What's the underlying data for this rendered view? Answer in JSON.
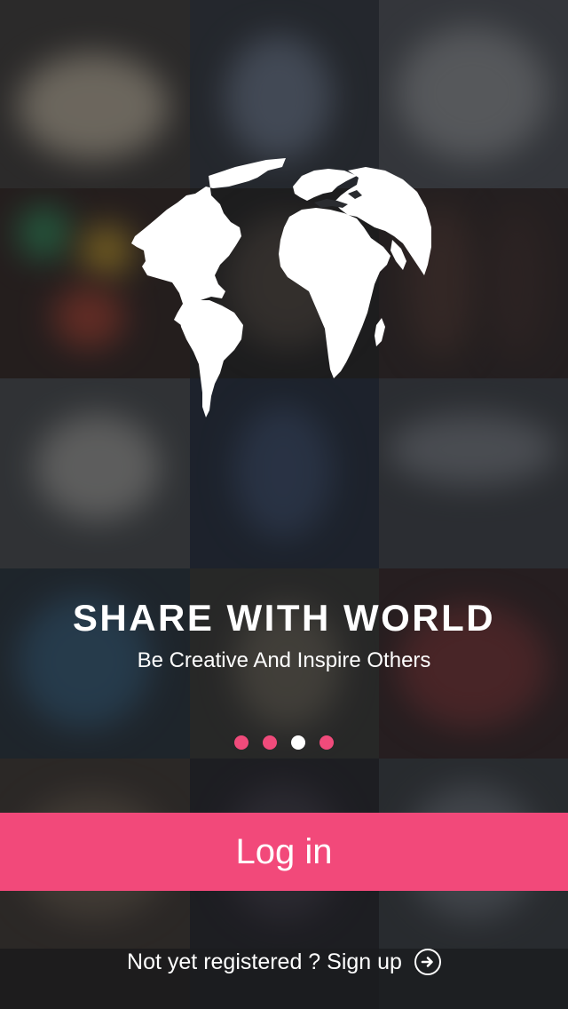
{
  "onboarding": {
    "headline": "SHARE WITH WORLD",
    "subline": "Be Creative And Inspire Others",
    "pager": {
      "total": 4,
      "active_index": 2
    }
  },
  "login_button": {
    "label": "Log in"
  },
  "signup_link": {
    "label": "Not yet registered ? Sign up",
    "icon": "arrow-right-circle-icon"
  },
  "logo": {
    "icon": "globe-icon"
  },
  "colors": {
    "accent": "#f2497a",
    "text": "#ffffff",
    "dot_inactive": "#f04b7b",
    "dot_active": "#ffffff"
  }
}
